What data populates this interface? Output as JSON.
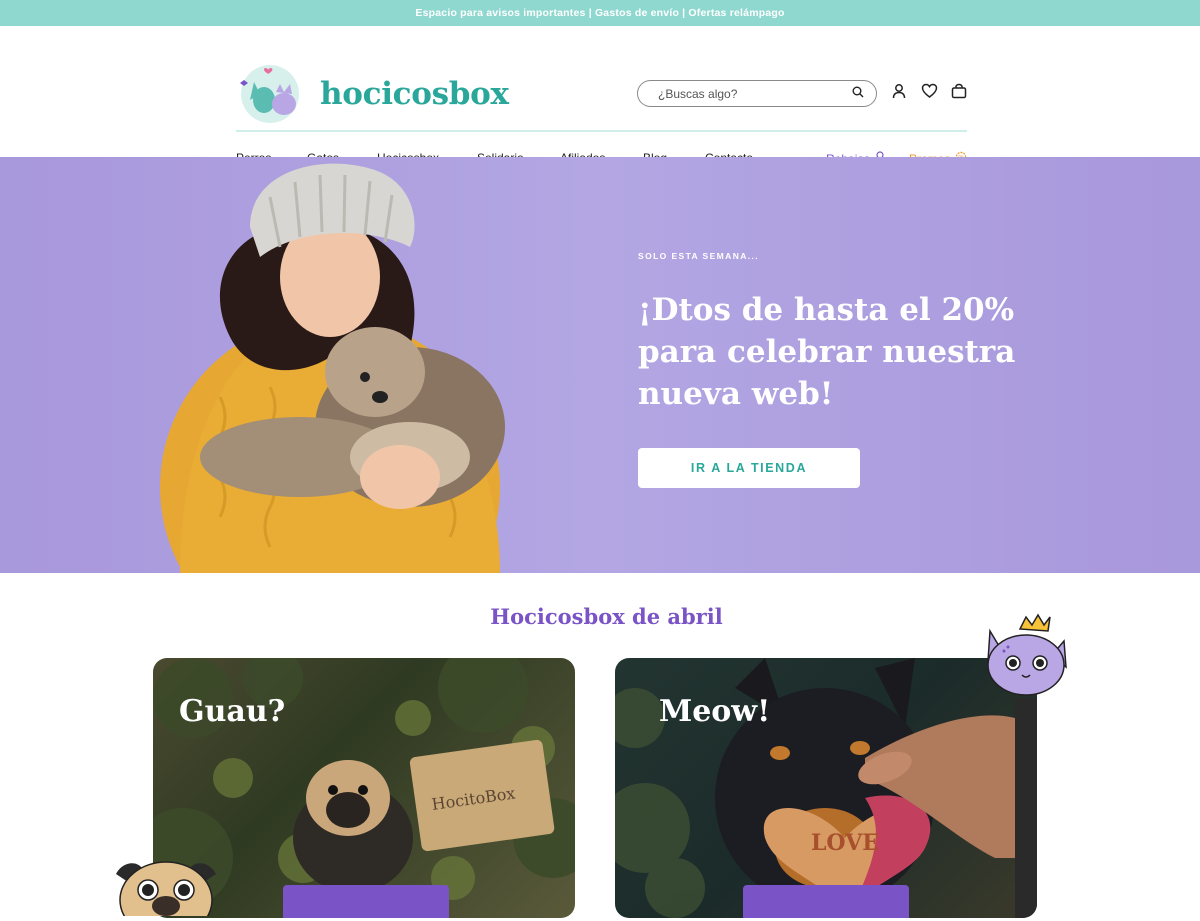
{
  "announcement": "Espacio para avisos importantes | Gastos de envío | Ofertas relámpago",
  "brand": {
    "name": "hocicosbox",
    "color": "#2aa79b",
    "accent_purple": "#7a54c7",
    "accent_orange": "#f0962a",
    "topbar_color": "#8fd8d0",
    "hero_color": "#ad9fe0"
  },
  "search": {
    "placeholder": "¿Buscas algo?",
    "icon": "search-icon"
  },
  "header_icons": [
    "user-icon",
    "heart-icon",
    "bag-icon"
  ],
  "nav": {
    "items": [
      {
        "label": "Perros"
      },
      {
        "label": "Gatos"
      },
      {
        "label": "Hocicosbox"
      },
      {
        "label": "Solidario"
      },
      {
        "label": "Afiliados"
      },
      {
        "label": "Blog"
      },
      {
        "label": "Contacto"
      }
    ],
    "sale_label": "Rebajas",
    "sale_icon": "award-icon",
    "promo_label": "Promos",
    "promo_icon": "badge-icon"
  },
  "hero": {
    "eyebrow": "SOLO ESTA SEMANA...",
    "headline": "¡Dtos de hasta el 20%\npara celebrar nuestra\nnueva web!",
    "cta_label": "IR A LA TIENDA"
  },
  "section": {
    "title": "Hocicosbox de abril"
  },
  "cards": [
    {
      "title": "Guau?"
    },
    {
      "title": "Meow!"
    }
  ]
}
